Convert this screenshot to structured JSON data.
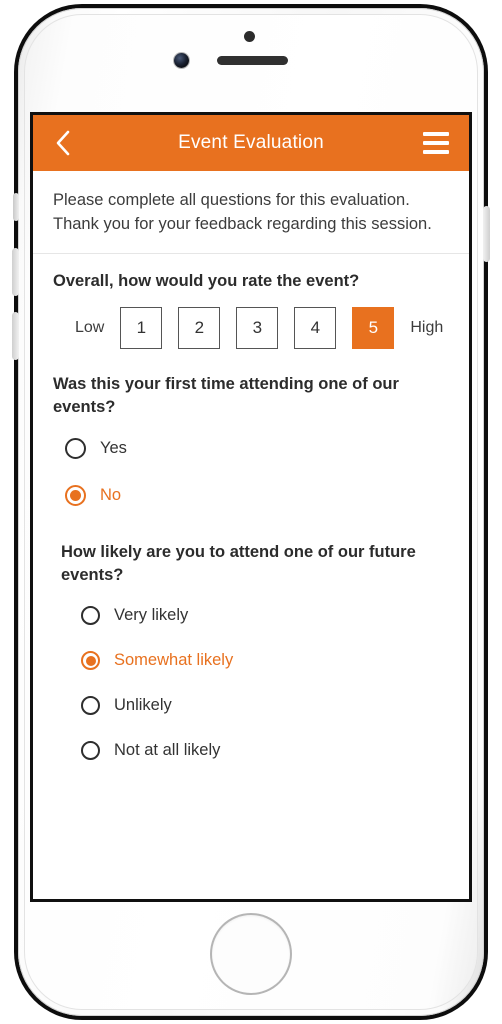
{
  "device": {
    "type": "smartphone",
    "sensors": [
      "proximity-sensor",
      "front-camera",
      "earpiece-speaker"
    ],
    "buttons": [
      "silent-switch",
      "volume-up",
      "volume-down",
      "power-button",
      "home-button"
    ]
  },
  "colors": {
    "accent": "#E8711F",
    "appbar_bg": "#E8711F",
    "appbar_text": "#FFFFFF",
    "screen_bg": "#FFFFFF",
    "body_text": "#333333",
    "divider": "#E6E6E6"
  },
  "appbar": {
    "title": "Event Evaluation",
    "back_icon": "chevron-left-icon",
    "menu_icon": "hamburger-menu-icon"
  },
  "intro": {
    "line1": "Please complete all questions for this evaluation.",
    "line2": "Thank you for your feedback regarding this session."
  },
  "questions": [
    {
      "id": "overall-rating",
      "title": "Overall, how would you rate the event?",
      "type": "rating-scale",
      "low_label": "Low",
      "high_label": "High",
      "options": [
        "1",
        "2",
        "3",
        "4",
        "5"
      ],
      "selected": "5"
    },
    {
      "id": "first-time",
      "title": "Was this your first time attending one of our events?",
      "type": "radio-group",
      "options": [
        "Yes",
        "No"
      ],
      "selected": "No"
    },
    {
      "id": "future-likelihood",
      "title": "How likely are you to attend one of our future events?",
      "type": "radio-group",
      "options": [
        "Very likely",
        "Somewhat likely",
        "Unlikely",
        "Not at all likely"
      ],
      "selected": "Somewhat likely"
    }
  ]
}
